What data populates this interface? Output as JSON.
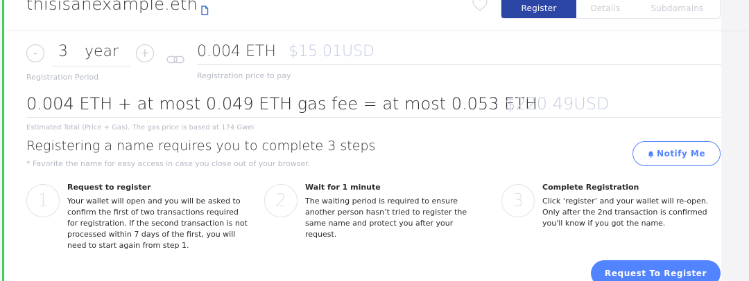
{
  "header": {
    "domain_name": "thisisanexample.eth",
    "tabs": [
      {
        "label": "Register",
        "active": true
      },
      {
        "label": "Details",
        "active": false
      },
      {
        "label": "Subdomains",
        "active": false
      }
    ]
  },
  "registration": {
    "decrement_symbol": "-",
    "increment_symbol": "+",
    "years_value": "3",
    "years_unit": "year",
    "period_label": "Registration Period",
    "price_eth": "0.004 ETH",
    "price_usd": "$15.01USD",
    "price_label": "Registration price to pay"
  },
  "total": {
    "text": "0.004 ETH + at most 0.049 ETH gas fee = at most 0.053 ETH",
    "usd": "$220.49USD",
    "label": "Estimated Total (Price + Gas). The gas price is based at 174 Gwei"
  },
  "steps_section": {
    "title": "Registering a name requires you to complete 3 steps",
    "note": "* Favorite the name for easy access in case you close out of your browser.",
    "notify_label": "Notify Me",
    "steps": [
      {
        "number": "1",
        "title": "Request to register",
        "description": "Your wallet will open and you will be asked to confirm the first of two transactions required for registration. If the second transaction is not processed within 7 days of the first, you will need to start again from step 1."
      },
      {
        "number": "2",
        "title": "Wait for 1 minute",
        "description": "The waiting period is required to ensure another person hasn’t tried to register the same name and protect you after your request."
      },
      {
        "number": "3",
        "title": "Complete Registration",
        "description": "Click ‘register’ and your wallet will re-open. Only after the 2nd transaction is confirmed you'll know if you got the name."
      }
    ],
    "register_button": "Request To Register"
  },
  "colors": {
    "accent": "#5284ff",
    "tab_active": "#2c46a6",
    "usd_muted": "#c4cbe0",
    "left_bar": "#3fcf5a"
  },
  "icons": [
    "copy-icon",
    "heart-icon",
    "link-icon",
    "bell-icon"
  ]
}
